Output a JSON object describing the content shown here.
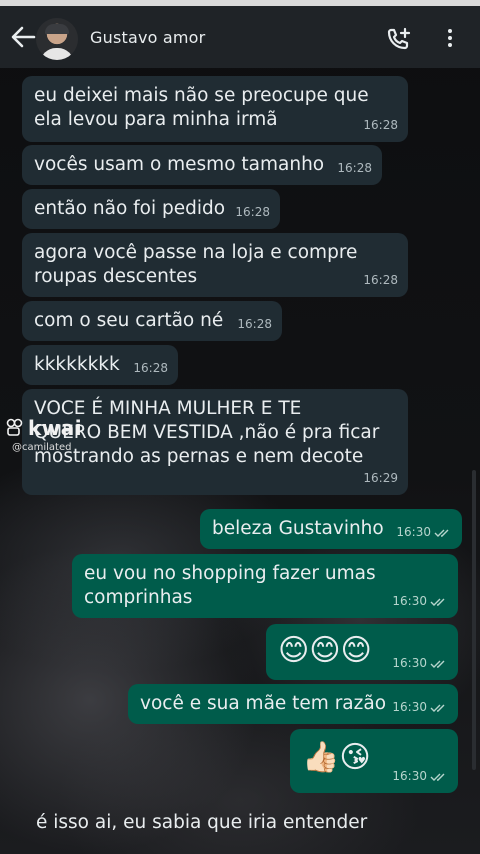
{
  "header": {
    "contact_name": "Gustavo amor"
  },
  "icons": {
    "back": "arrow-left-icon",
    "call": "add-call-icon",
    "menu": "more-vertical-icon"
  },
  "colors": {
    "incoming_bubble": "#202c33",
    "outgoing_bubble": "#005c4b",
    "header": "#1f2327"
  },
  "messages": [
    {
      "dir": "in",
      "text": "eu deixei mais não se preocupe que\nela levou para minha irmã",
      "time": "16:28"
    },
    {
      "dir": "in",
      "text": "vocês usam o mesmo tamanho",
      "time": "16:28"
    },
    {
      "dir": "in",
      "text": "então não foi pedido",
      "time": "16:28"
    },
    {
      "dir": "in",
      "text": "agora você passe na loja e compre\nroupas descentes",
      "time": "16:28"
    },
    {
      "dir": "in",
      "text": "com o seu cartão né",
      "time": "16:28"
    },
    {
      "dir": "in",
      "text": "kkkkkkkk",
      "time": "16:28"
    },
    {
      "dir": "in",
      "text": "VOCE É MINHA MULHER E TE\nQUERO BEM VESTIDA ,não é pra ficar\nmostrando as pernas e nem decote",
      "time": "16:29"
    },
    {
      "dir": "out",
      "text": "beleza Gustavinho",
      "time": "16:30"
    },
    {
      "dir": "out",
      "text": "eu vou no shopping fazer umas\ncomprinhas",
      "time": "16:30"
    },
    {
      "dir": "out",
      "text": "😊😊😊",
      "time": "16:30"
    },
    {
      "dir": "out",
      "text": "você e sua mãe tem razão",
      "time": "16:30"
    },
    {
      "dir": "out",
      "text": "👍🏻😘",
      "time": "16:30"
    }
  ],
  "partial_message": "é isso ai, eu sabia que iria entender",
  "watermark": {
    "brand": "kwai",
    "handle": "@camilated"
  }
}
